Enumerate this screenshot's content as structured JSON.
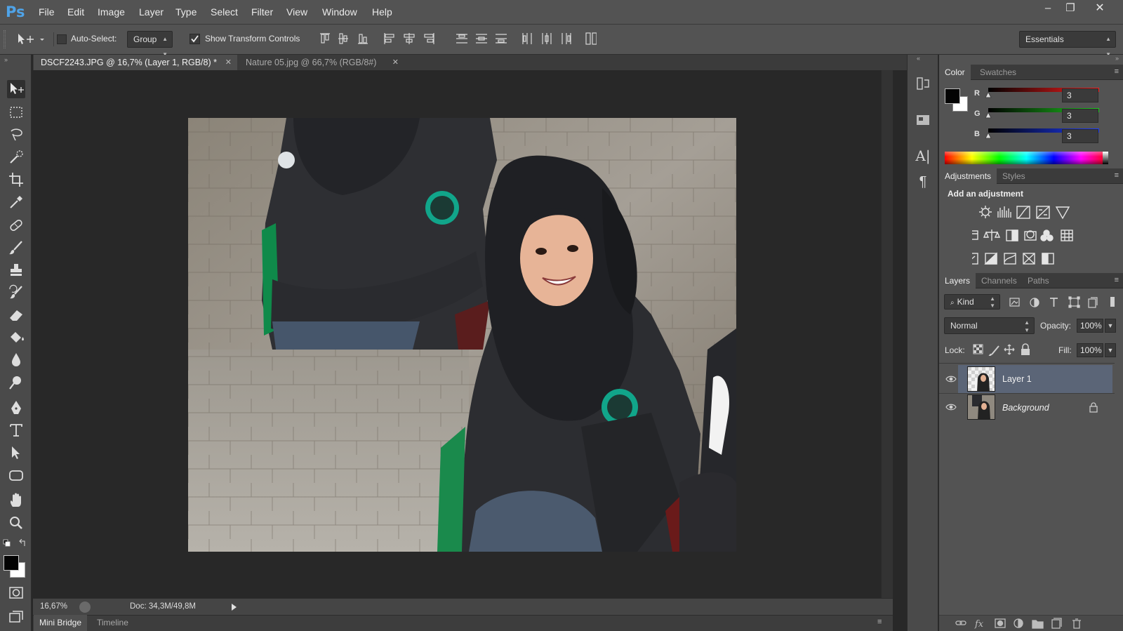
{
  "app": {
    "logo": "Ps"
  },
  "menu": [
    "File",
    "Edit",
    "Image",
    "Layer",
    "Type",
    "Select",
    "Filter",
    "View",
    "Window",
    "Help"
  ],
  "window_controls": {
    "minimize": "–",
    "restore": "❐",
    "close": "✕"
  },
  "options": {
    "auto_select_label": "Auto-Select:",
    "auto_select_checked": false,
    "auto_select_target": "Group",
    "show_transform_label": "Show Transform Controls",
    "show_transform_checked": true,
    "workspace": "Essentials"
  },
  "documents": [
    {
      "title": "DSCF2243.JPG @ 16,7% (Layer 1, RGB/8) *",
      "close": "✕",
      "active": true
    },
    {
      "title": "Nature 05.jpg @ 66,7% (RGB/8#)",
      "close": "✕",
      "active": false
    }
  ],
  "status": {
    "zoom": "16,67%",
    "doc_info": "Doc: 34,3M/49,8M"
  },
  "bottom_tabs": [
    "Mini Bridge",
    "Timeline"
  ],
  "color_panel": {
    "tabs": [
      "Color",
      "Swatches"
    ],
    "channels": [
      {
        "label": "R",
        "value": "3",
        "gradient_end": "#ff1e1e"
      },
      {
        "label": "G",
        "value": "3",
        "gradient_end": "#1ec81e"
      },
      {
        "label": "B",
        "value": "3",
        "gradient_end": "#1e3cff"
      }
    ],
    "foreground": "#030303",
    "background": "#ffffff"
  },
  "adjustments_panel": {
    "tabs": [
      "Adjustments",
      "Styles"
    ],
    "heading": "Add an adjustment",
    "rows": [
      [
        "brightness-contrast-icon",
        "levels-icon",
        "curves-icon",
        "exposure-icon",
        "gradient-triangle-icon"
      ],
      [
        "vibrance-icon",
        "color-balance-icon",
        "black-white-icon",
        "photo-filter-icon",
        "channel-mixer-icon",
        "color-lookup-icon"
      ],
      [
        "invert-icon",
        "posterize-icon",
        "threshold-icon",
        "selective-color-icon",
        "gradient-map-icon"
      ]
    ]
  },
  "layers_panel": {
    "tabs": [
      "Layers",
      "Channels",
      "Paths"
    ],
    "filter_kind": "Kind",
    "blend_mode": "Normal",
    "opacity_label": "Opacity:",
    "opacity": "100%",
    "lock_label": "Lock:",
    "fill_label": "Fill:",
    "fill": "100%",
    "layers": [
      {
        "name": "Layer 1",
        "selected": true,
        "visible": true,
        "locked": false
      },
      {
        "name": "Background",
        "selected": false,
        "visible": true,
        "locked": true
      }
    ]
  }
}
